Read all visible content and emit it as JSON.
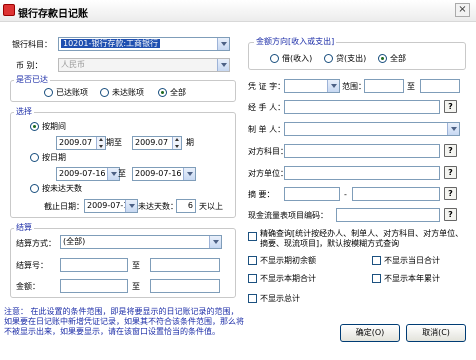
{
  "window": {
    "title": "银行存款日记账",
    "close": "×"
  },
  "left": {
    "bank_account_label": "银行科目：",
    "bank_account_value": "10201-银行存款:工商银行",
    "currency_label": "币  别：",
    "currency_value": "人民币",
    "reconciled_title": "是否已达",
    "reconciled_options": [
      "已达账项",
      "未达账项",
      "全部"
    ],
    "select_title": "选择",
    "by_period": "按期间",
    "period_from": "2009.07",
    "period_to_label": "期至",
    "period_to": "2009.07",
    "period_suffix": "期",
    "by_date": "按日期",
    "date_from": "2009-07-16",
    "date_to_label": "至",
    "date_to": "2009-07-16",
    "by_unreached_days": "按未达天数",
    "deadline_label": "截止日期：",
    "deadline_value": "2009-07-16",
    "unreached_days_label": "未达天数：",
    "unreached_days_value": "6",
    "days_suffix": "天以上",
    "settle_title": "结算",
    "settle_method_label": "结算方式：",
    "settle_method_value": "(全部)",
    "settle_no_label": "结算号：",
    "settle_no_to": "至",
    "amount_label": "金额：",
    "amount_to": "至",
    "note": "注意：              在此设置的条件范围，即是将要显示的日记账记录的范围，如果要在日记账中新增凭证记录，如果其不符合该条件范围，那么将不被显示出来，如果要显示，请在该窗口设置恰当的条件值。"
  },
  "right": {
    "direction_title": "金额方向[收入或支出]",
    "direction_options": [
      "借(收入)",
      "贷(支出)",
      "全部"
    ],
    "voucher_label": "凭 证 字：",
    "range_label": "范围：",
    "range_to": "至",
    "handler_label": "经 手 人：",
    "maker_label": "制 单 人：",
    "counter_subject_label": "对方科目：",
    "counter_unit_label": "对方单位：",
    "summary_label": "摘    要：",
    "cashflow_label": "现金流量表项目编码：",
    "exact_query_text": "精确查询[统计按经办人、制单人、对方科目、对方单位、摘要、现流项目]，默认按模糊方式查询",
    "hide_options": [
      "不显示期初余额",
      "不显示当日合计",
      "不显示本期合计",
      "不显示本年累计",
      "不显示总计"
    ],
    "ok_button": "确定(O)",
    "cancel_button": "取消(C)",
    "help_icon_text": "?"
  }
}
